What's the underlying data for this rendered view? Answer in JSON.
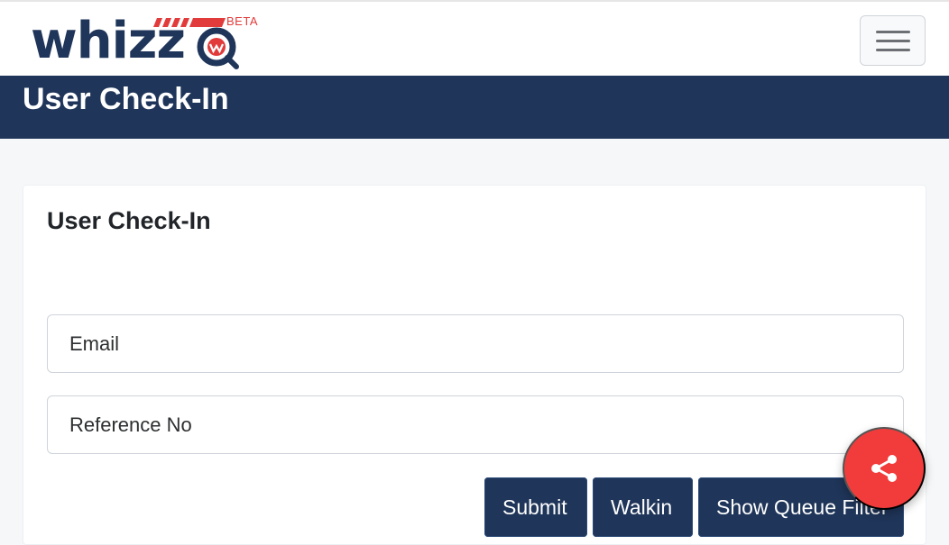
{
  "header": {
    "logo_text": "whizzq",
    "logo_badge": "BETA",
    "menu_icon": "hamburger-icon"
  },
  "banner": {
    "title": "User Check-In"
  },
  "card": {
    "title": "User Check-In",
    "email_placeholder": "Email",
    "reference_placeholder": "Reference No",
    "buttons": {
      "submit": "Submit",
      "walkin": "Walkin",
      "show_queue_filter": "Show Queue Filter"
    }
  },
  "fab": {
    "icon": "share-icon"
  },
  "colors": {
    "brand_navy": "#1f3559",
    "accent_red": "#f23c3c"
  }
}
